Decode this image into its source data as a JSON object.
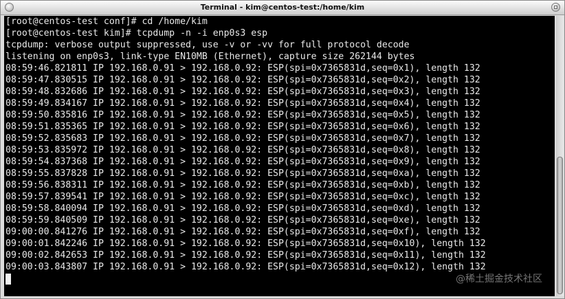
{
  "window": {
    "title": "Terminal - kim@centos-test:/home/kim"
  },
  "terminal": {
    "lines": [
      "[root@centos-test conf]# cd /home/kim",
      "[root@centos-test kim]# tcpdump -n -i enp0s3 esp",
      "tcpdump: verbose output suppressed, use -v or -vv for full protocol decode",
      "listening on enp0s3, link-type EN10MB (Ethernet), capture size 262144 bytes",
      "08:59:46.821811 IP 192.168.0.91 > 192.168.0.92: ESP(spi=0x7365831d,seq=0x1), length 132",
      "08:59:47.830515 IP 192.168.0.91 > 192.168.0.92: ESP(spi=0x7365831d,seq=0x2), length 132",
      "08:59:48.832686 IP 192.168.0.91 > 192.168.0.92: ESP(spi=0x7365831d,seq=0x3), length 132",
      "08:59:49.834167 IP 192.168.0.91 > 192.168.0.92: ESP(spi=0x7365831d,seq=0x4), length 132",
      "08:59:50.835816 IP 192.168.0.91 > 192.168.0.92: ESP(spi=0x7365831d,seq=0x5), length 132",
      "08:59:51.835365 IP 192.168.0.91 > 192.168.0.92: ESP(spi=0x7365831d,seq=0x6), length 132",
      "08:59:52.835683 IP 192.168.0.91 > 192.168.0.92: ESP(spi=0x7365831d,seq=0x7), length 132",
      "08:59:53.835972 IP 192.168.0.91 > 192.168.0.92: ESP(spi=0x7365831d,seq=0x8), length 132",
      "08:59:54.837368 IP 192.168.0.91 > 192.168.0.92: ESP(spi=0x7365831d,seq=0x9), length 132",
      "08:59:55.837828 IP 192.168.0.91 > 192.168.0.92: ESP(spi=0x7365831d,seq=0xa), length 132",
      "08:59:56.838311 IP 192.168.0.91 > 192.168.0.92: ESP(spi=0x7365831d,seq=0xb), length 132",
      "08:59:57.839541 IP 192.168.0.91 > 192.168.0.92: ESP(spi=0x7365831d,seq=0xc), length 132",
      "08:59:58.840094 IP 192.168.0.91 > 192.168.0.92: ESP(spi=0x7365831d,seq=0xd), length 132",
      "08:59:59.840509 IP 192.168.0.91 > 192.168.0.92: ESP(spi=0x7365831d,seq=0xe), length 132",
      "09:00:00.841276 IP 192.168.0.91 > 192.168.0.92: ESP(spi=0x7365831d,seq=0xf), length 132",
      "09:00:01.842246 IP 192.168.0.91 > 192.168.0.92: ESP(spi=0x7365831d,seq=0x10), length 132",
      "09:00:02.842653 IP 192.168.0.91 > 192.168.0.92: ESP(spi=0x7365831d,seq=0x11), length 132",
      "09:00:03.843807 IP 192.168.0.91 > 192.168.0.92: ESP(spi=0x7365831d,seq=0x12), length 132"
    ]
  },
  "watermark": {
    "text": "@稀土掘金技术社区"
  },
  "colors": {
    "terminal_background": "#000000",
    "terminal_foreground": "#e8e8e8",
    "cursor": "#f2f2f2"
  }
}
